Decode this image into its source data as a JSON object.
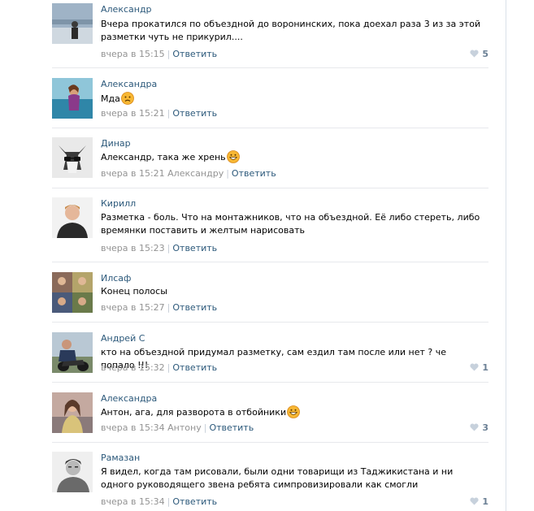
{
  "reply_label": "Ответить",
  "colors": {
    "link": "#2b587a",
    "meta": "#939393",
    "separator": "#e7e8ec",
    "like": "#6a7f94"
  },
  "comments": [
    {
      "author": "Александр",
      "text": "Вчера прокатился по объездной до воронинских, пока доехал раза 3 из за этой разметки чуть не прикурил....",
      "time": "вчера в 15:15",
      "reply_to": "",
      "likes": "5",
      "emoji": ""
    },
    {
      "author": "Александра",
      "text": "Мда",
      "time": "вчера в 15:21",
      "reply_to": "",
      "likes": "",
      "emoji": "sad-face"
    },
    {
      "author": "Динар",
      "text": "Александр, така же хрень",
      "time": "вчера в 15:21",
      "reply_to": "Александру",
      "likes": "",
      "emoji": "grin-face"
    },
    {
      "author": "Кирилл",
      "text": "Разметка - боль. Что на монтажников, что на объездной. Её либо стереть, либо времянки поставить и желтым нарисовать",
      "time": "вчера в 15:23",
      "reply_to": "",
      "likes": "",
      "emoji": ""
    },
    {
      "author": "Илсаф",
      "text": "Конец полосы",
      "time": "вчера в 15:27",
      "reply_to": "",
      "likes": "",
      "emoji": ""
    },
    {
      "author": "Андрей С",
      "text": "кто на объездной придумал разметку, сам ездил там после или нет ? че попало !!!",
      "time": "вчера в 15:32",
      "reply_to": "",
      "likes": "1",
      "emoji": ""
    },
    {
      "author": "Александра",
      "text": "Антон, ага, для разворота в отбойники",
      "time": "вчера в 15:34",
      "reply_to": "Антону",
      "likes": "3",
      "emoji": "grin-face"
    },
    {
      "author": "Рамазан",
      "text": "Я видел, когда там рисовали, были одни товарищи из Таджикистана и ни одного руководящего звена ребята симпровизировали как смогли",
      "time": "вчера в 15:34",
      "reply_to": "",
      "likes": "1",
      "emoji": ""
    }
  ]
}
